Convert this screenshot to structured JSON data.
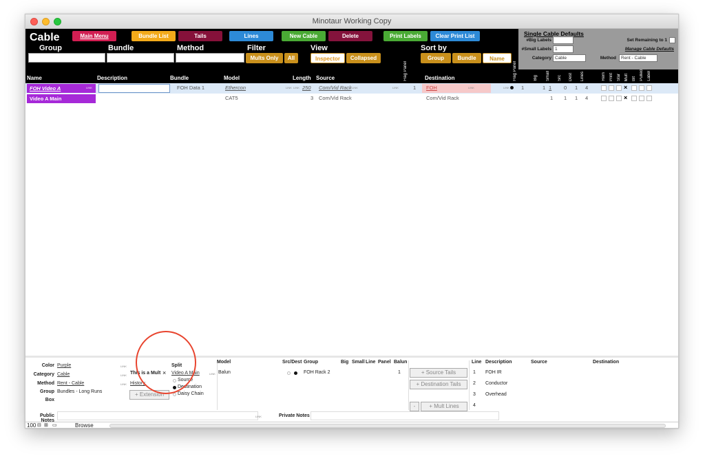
{
  "window": {
    "title": "Minotaur Working Copy"
  },
  "header": {
    "title": "Cable",
    "main_menu": "Main Menu",
    "bundle_list": "Bundle List",
    "tails": "Tails",
    "lines": "Lines",
    "new_cable": "New Cable",
    "delete": "Delete",
    "print_labels": "Print Labels",
    "clear_print_list": "Clear Print List",
    "group_label": "Group",
    "bundle_label": "Bundle",
    "method_label": "Method",
    "filter_label": "Filter",
    "mults_only": "Mults Only",
    "all": "All",
    "view_label": "View",
    "inspector": "Inspector",
    "collapsed": "Collapsed",
    "sort_by_label": "Sort by",
    "sort_group": "Group",
    "sort_bundle": "Bundle",
    "sort_name": "Name"
  },
  "defaults": {
    "title": "Single Cable Defaults",
    "big_labels": "#Big Labels",
    "small_labels": "#Small Labels",
    "small_labels_value": "1",
    "category_label": "Category",
    "category_value": "Cable",
    "set_remaining": "Set Remaining to 1",
    "manage": "Manage Cable Defaults",
    "method_label": "Method",
    "method_value": "Rent - Cable"
  },
  "columns": {
    "name": "Name",
    "description": "Description",
    "bundle": "Bundle",
    "model": "Model",
    "length": "Length",
    "source": "Source",
    "flag_panel": "Flag Panel",
    "destination": "Destination",
    "dest_flag_panel": "Flag Panel",
    "big": "Big",
    "small": "Small",
    "src": "Src",
    "dest": "Dest",
    "lines": "Lines",
    "rem": "Rem",
    "print": "Print",
    "star": "Star",
    "mult": "Mult",
    "bit": "Bit",
    "pulled": "Pulled",
    "label": "Label"
  },
  "rows": [
    {
      "name": "FOH Video A",
      "description": "",
      "bundle": "FOH Data 1",
      "model": "Ethercon",
      "length": "250",
      "source": "Com/Vid Rack",
      "source_panel": "1",
      "destination": "FOH",
      "dest_panel": "1",
      "big": "1",
      "small": "1",
      "src": "0",
      "dest": "1",
      "lines": "4",
      "mult_x": "×"
    },
    {
      "name": "Video A Main",
      "description": "",
      "bundle": "",
      "model": "CAT5",
      "length": "3",
      "source": "Com/Vid Rack",
      "destination": "Com/Vid Rack",
      "small": "1",
      "src": "1",
      "dest": "1",
      "lines": "4",
      "mult_x": "×"
    }
  ],
  "link_tag": "LINK",
  "inspector": {
    "color_label": "Color",
    "color_value": "Purple",
    "category_label": "Category",
    "category_value": "Cable",
    "method_label": "Method",
    "method_value": "Rent - Cable",
    "group_label": "Group",
    "group_value": "Bundles - Long Runs",
    "box_label": "Box",
    "mult_text": "This is a Mult",
    "mult_x": "×",
    "history": "History",
    "extension": "+ Extension",
    "split_label": "Split",
    "split_value": "Video A Main",
    "split_options": [
      "Source",
      "Destination",
      "Daisy Chain"
    ],
    "model_header": "Model",
    "model_value": "Balun",
    "srcdest_header": "Src/Dest",
    "group_header": "Group",
    "big_header": "Big",
    "small_header": "Small",
    "line_header": "Line",
    "panel_header": "Panel",
    "balun_header": "Balun",
    "tail_group": "FOH Rack 2",
    "tail_balun": "1",
    "source_tails": "+ Source Tails",
    "dest_tails": "+ Destination Tails",
    "minus": "-",
    "mult_lines": "+ Mult Lines",
    "lines_header": "Line",
    "desc_header": "Description",
    "src_header": "Source",
    "dst_header": "Destination",
    "lines": [
      {
        "line": "1",
        "desc": "FOH IR"
      },
      {
        "line": "2",
        "desc": "Conductor"
      },
      {
        "line": "3",
        "desc": "Overhead"
      },
      {
        "line": "4",
        "desc": ""
      }
    ],
    "public_notes": "Public Notes",
    "private_notes": "Private Notes"
  },
  "status": {
    "zoom": "100",
    "mode": "Browse"
  }
}
